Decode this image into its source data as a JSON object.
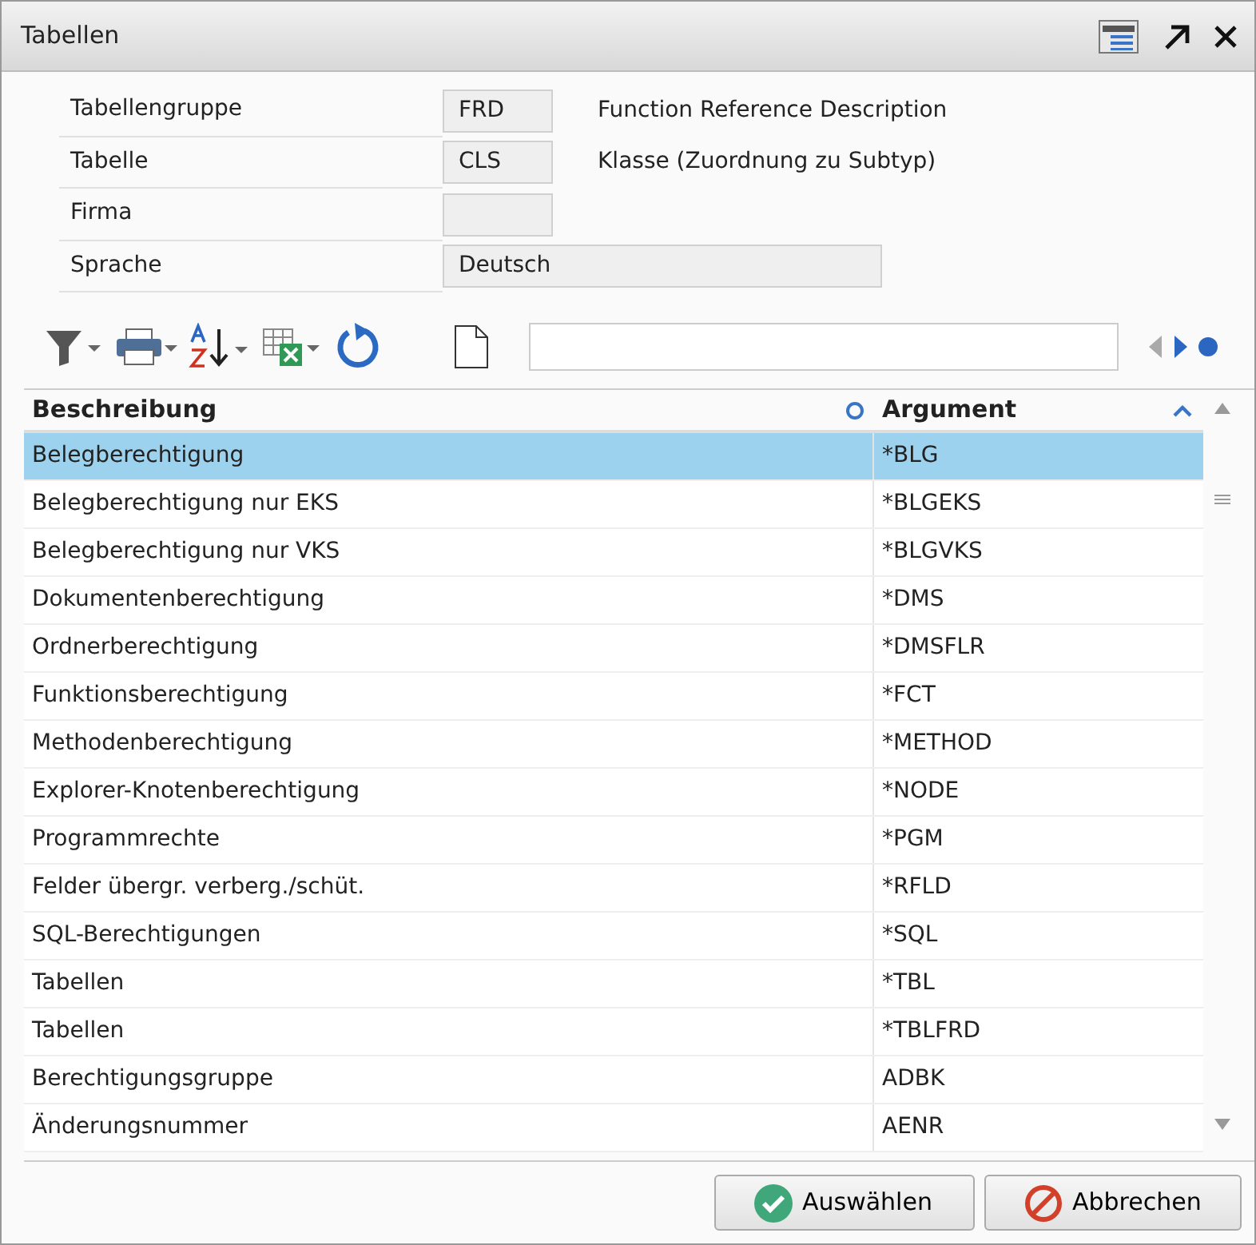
{
  "window": {
    "title": "Tabellen"
  },
  "form": [
    {
      "label": "Tabellengruppe",
      "value": "FRD",
      "description": "Function Reference Description",
      "kind": "short"
    },
    {
      "label": "Tabelle",
      "value": "CLS",
      "description": "Klasse (Zuordnung zu Subtyp)",
      "kind": "short"
    },
    {
      "label": "Firma",
      "kind": "short"
    },
    {
      "label": "Sprache",
      "value": "Deutsch",
      "kind": "wide"
    }
  ],
  "table": {
    "columns": [
      "Beschreibung",
      "Argument"
    ],
    "rows": [
      {
        "cells": [
          "Belegberechtigung",
          "*BLG"
        ],
        "selected": true
      },
      {
        "cells": [
          "Belegberechtigung nur EKS",
          "*BLGEKS"
        ],
        "selected": false
      },
      {
        "cells": [
          "Belegberechtigung nur VKS",
          "*BLGVKS"
        ],
        "selected": false
      },
      {
        "cells": [
          "Dokumentenberechtigung",
          "*DMS"
        ],
        "selected": false
      },
      {
        "cells": [
          "Ordnerberechtigung",
          "*DMSFLR"
        ],
        "selected": false
      },
      {
        "cells": [
          "Funktionsberechtigung",
          "*FCT"
        ],
        "selected": false
      },
      {
        "cells": [
          "Methodenberechtigung",
          "*METHOD"
        ],
        "selected": false
      },
      {
        "cells": [
          "Explorer-Knotenberechtigung",
          "*NODE"
        ],
        "selected": false
      },
      {
        "cells": [
          "Programmrechte",
          "*PGM"
        ],
        "selected": false
      },
      {
        "cells": [
          "Felder übergr. verberg./schüt.",
          "*RFLD"
        ],
        "selected": false
      },
      {
        "cells": [
          "SQL-Berechtigungen",
          "*SQL"
        ],
        "selected": false
      },
      {
        "cells": [
          "Tabellen",
          "*TBL"
        ],
        "selected": false
      },
      {
        "cells": [
          "Tabellen",
          "*TBLFRD"
        ],
        "selected": false
      },
      {
        "cells": [
          "Berechtigungsgruppe",
          "ADBK"
        ],
        "selected": false
      },
      {
        "cells": [
          "Änderungsnummer",
          "AENR"
        ],
        "selected": false
      }
    ]
  },
  "buttons": [
    {
      "label": "Auswählen",
      "kind": "ok"
    },
    {
      "label": "Abbrechen",
      "kind": "cancel"
    }
  ]
}
